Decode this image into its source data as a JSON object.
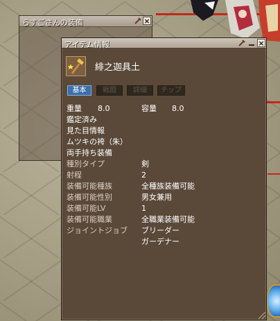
{
  "equip_window": {
    "title": "らすごさんの装備"
  },
  "item_window": {
    "title": "アイテム情報",
    "item_name": "緋之迦具土",
    "tabs": [
      {
        "label": "基本",
        "active": true
      },
      {
        "label": "戦闘",
        "active": false
      },
      {
        "label": "詳細",
        "active": false
      },
      {
        "label": "チップ",
        "active": false
      }
    ],
    "weight_label": "重量",
    "weight_value": "8.0",
    "capacity_label": "容量",
    "capacity_value": "8.0",
    "lines": [
      "鑑定済み",
      "見た目情報",
      "ムツキの袴（朱）",
      "両手持ち装備"
    ],
    "attributes": [
      {
        "label": "種別タイプ",
        "value": "剣"
      },
      {
        "label": "射程",
        "value": "2"
      },
      {
        "label": "装備可能種族",
        "value": "全種族装備可能"
      },
      {
        "label": "装備可能性別",
        "value": "男女兼用"
      },
      {
        "label": "装備可能LV",
        "value": "1"
      },
      {
        "label": "装備可能職業",
        "value": "全職業装備可能"
      },
      {
        "label": "ジョイントジョブ",
        "value": "ブリーダー"
      },
      {
        "label": "",
        "value": "ガーデナー"
      }
    ]
  },
  "icons": {
    "titlebar_tool": "wrench-icon",
    "titlebar_minimize": "minimize-icon",
    "titlebar_close": "close-icon",
    "item": "hammer-icon",
    "item_star": "star-icon"
  },
  "colors": {
    "window_bg": "#5a4939",
    "active_tab": "#3d6fa8",
    "text": "#ffffff"
  }
}
